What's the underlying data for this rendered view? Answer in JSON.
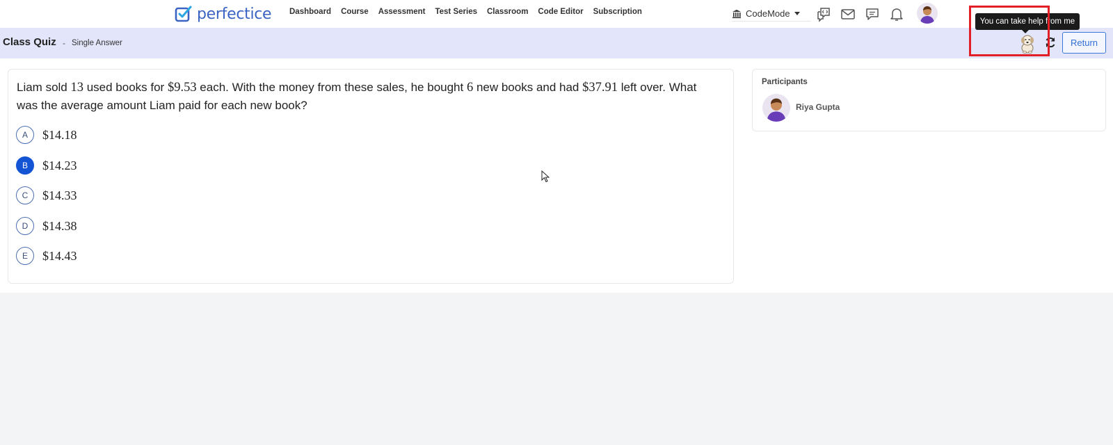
{
  "brand": {
    "name": "perfectice",
    "color": "#3a63c4"
  },
  "nav": {
    "links": [
      "Dashboard",
      "Course",
      "Assessment",
      "Test Series",
      "Classroom",
      "Code Editor",
      "Subscription"
    ],
    "codemode_label": "CodeMode",
    "icons": [
      "bank-icon",
      "code-chat-icon",
      "mail-icon",
      "chat-icon",
      "bell-icon",
      "user-avatar"
    ]
  },
  "quiz": {
    "title": "Class Quiz",
    "separator": "-",
    "type": "Single Answer",
    "return_label": "Return",
    "tooltip": "You can take help from me"
  },
  "question": {
    "parts": [
      "Liam sold ",
      "13",
      " used books for ",
      "$9.53",
      " each. With the money from these sales, he bought ",
      "6",
      " new books and had ",
      "$37.91",
      " left over. What was the average amount Liam paid for each new book?"
    ],
    "options": [
      {
        "letter": "A",
        "value": "$14.18",
        "selected": false
      },
      {
        "letter": "B",
        "value": "$14.23",
        "selected": true
      },
      {
        "letter": "C",
        "value": "$14.33",
        "selected": false
      },
      {
        "letter": "D",
        "value": "$14.38",
        "selected": false
      },
      {
        "letter": "E",
        "value": "$14.43",
        "selected": false
      }
    ]
  },
  "participants": {
    "label": "Participants",
    "list": [
      {
        "name": "Riya Gupta"
      }
    ]
  },
  "colors": {
    "accent": "#1254d4",
    "highlight": "#e21f26",
    "subheader": "#e3e5fb"
  }
}
